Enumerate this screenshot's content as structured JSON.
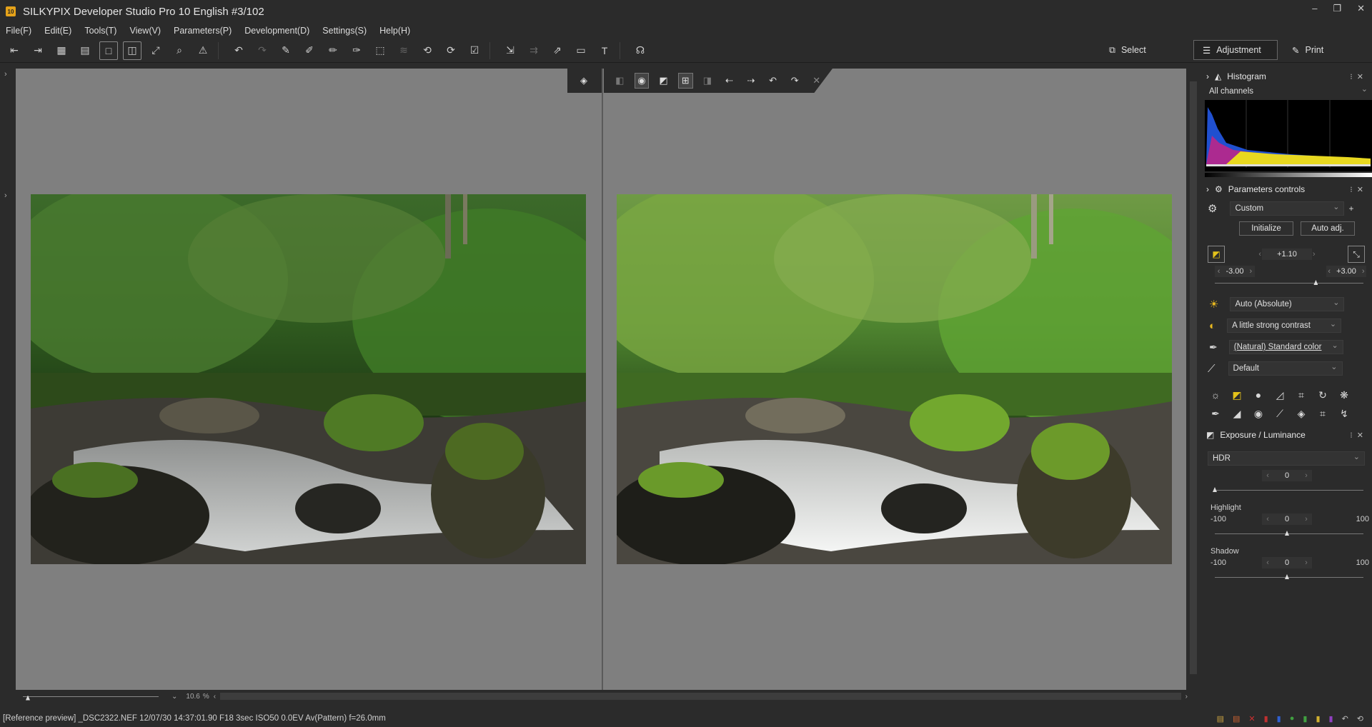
{
  "window": {
    "title": "SILKYPIX Developer Studio Pro 10 English  #3/102",
    "app_icon": "10"
  },
  "menu": [
    "File(F)",
    "Edit(E)",
    "Tools(T)",
    "View(V)",
    "Parameters(P)",
    "Development(D)",
    "Settings(S)",
    "Help(H)"
  ],
  "modes": {
    "select": "Select",
    "adjustment": "Adjustment",
    "print": "Print"
  },
  "histogram": {
    "title": "Histogram",
    "channel": "All channels"
  },
  "params": {
    "title": "Parameters controls",
    "preset": "Custom",
    "initialize": "Initialize",
    "auto_adj": "Auto adj.",
    "exposure_value": "+1.10",
    "range_min": "-3.00",
    "range_max": "+3.00",
    "exposure_level": 0.68,
    "white_balance": "Auto (Absolute)",
    "tone": "A little strong contrast",
    "color": "(Natural) Standard color",
    "sharpness": "Default"
  },
  "exposure_panel": {
    "title": "Exposure / Luminance",
    "mode": "HDR",
    "hdr_value": "0",
    "highlight_label": "Highlight",
    "highlight_value": "0",
    "shadow_label": "Shadow",
    "shadow_value": "0",
    "min": "-100",
    "max": "100"
  },
  "zoom": {
    "value": "10.6",
    "unit": "%"
  },
  "status": "[Reference preview] _DSC2322.NEF 12/07/30 14:37:01.90 F18 3sec ISO50  0.0EV Av(Pattern) f=26.0mm"
}
